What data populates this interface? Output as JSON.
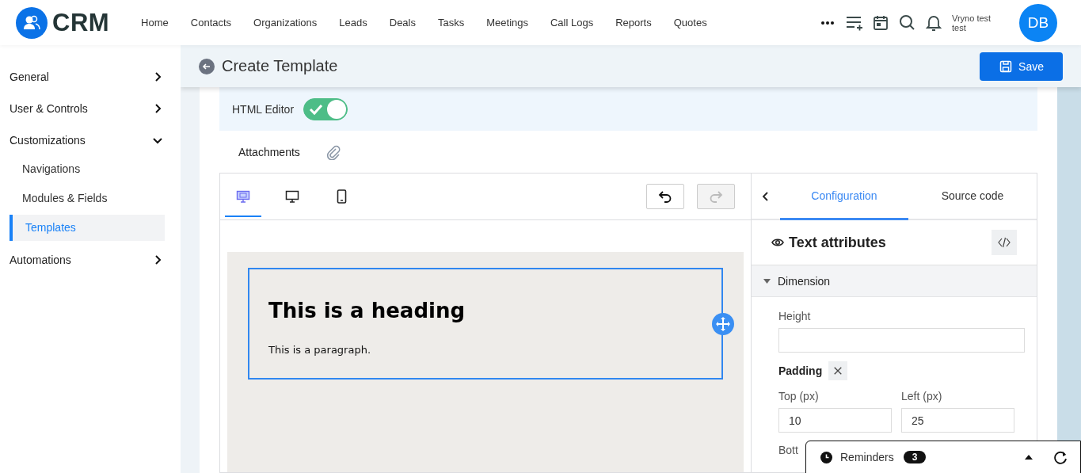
{
  "header": {
    "logo": "CRM",
    "nav": [
      "Home",
      "Contacts",
      "Organizations",
      "Leads",
      "Deals",
      "Tasks",
      "Meetings",
      "Call Logs",
      "Reports",
      "Quotes"
    ],
    "user": {
      "name": "Vryno test test",
      "initials": "DB"
    }
  },
  "sidebar": {
    "items": [
      {
        "label": "General",
        "expanded": false
      },
      {
        "label": "User & Controls",
        "expanded": false
      },
      {
        "label": "Customizations",
        "expanded": true,
        "children": [
          {
            "label": "Navigations",
            "selected": false
          },
          {
            "label": "Modules & Fields",
            "selected": false
          },
          {
            "label": "Templates",
            "selected": true
          }
        ]
      },
      {
        "label": "Automations",
        "expanded": false
      }
    ]
  },
  "page": {
    "title": "Create Template",
    "save_button": "Save"
  },
  "html_editor": {
    "label": "HTML Editor",
    "on": true
  },
  "attachments": {
    "label": "Attachments"
  },
  "editor": {
    "devices": [
      {
        "kind": "responsive",
        "selected": true
      },
      {
        "kind": "desktop",
        "selected": false
      },
      {
        "kind": "mobile",
        "selected": false
      }
    ],
    "undo": {
      "disabled": false
    },
    "redo": {
      "disabled": true
    },
    "canvas": {
      "heading": "This is a heading",
      "paragraph": "This is a paragraph."
    }
  },
  "panel": {
    "tabs": [
      {
        "label": "Configuration",
        "selected": true
      },
      {
        "label": "Source code",
        "selected": false
      }
    ],
    "section_title": "Text attributes",
    "group": {
      "label": "Dimension",
      "expanded": true
    },
    "height": {
      "label": "Height"
    },
    "padding": {
      "label": "Padding",
      "top": {
        "label": "Top (px)",
        "value": "10"
      },
      "left": {
        "label": "Left (px)",
        "value": "25"
      },
      "bottom": {
        "label": "Bott"
      }
    }
  },
  "reminders": {
    "label": "Reminders",
    "count": "3"
  }
}
